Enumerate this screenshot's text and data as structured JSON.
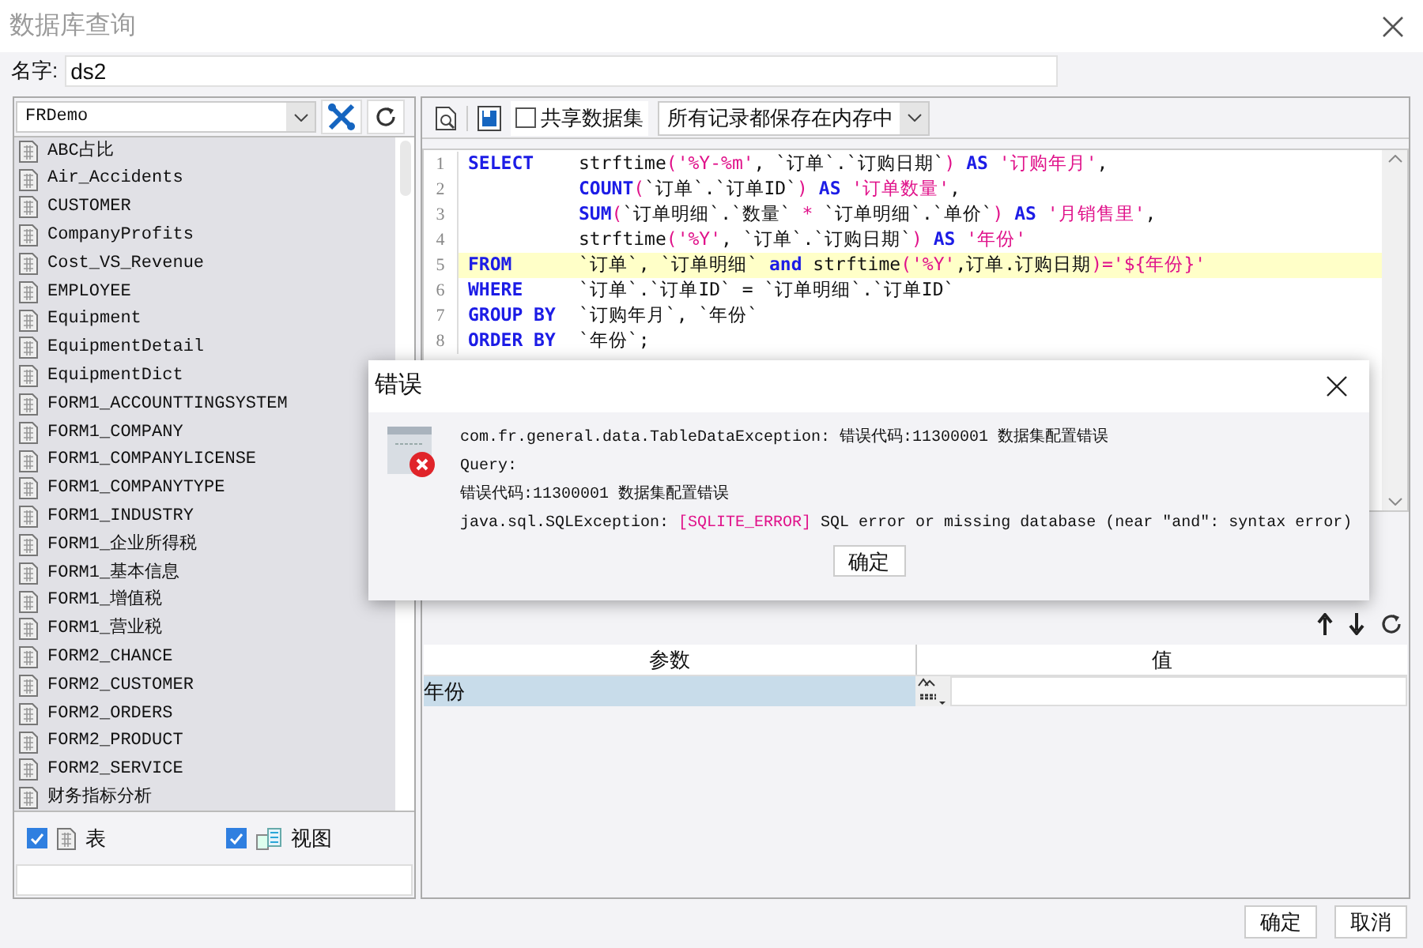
{
  "window": {
    "title": "数据库查询"
  },
  "name_field": {
    "label": "名字:",
    "value": "ds2"
  },
  "connection": {
    "value": "FRDemo"
  },
  "tables": [
    "ABC占比",
    "Air_Accidents",
    "CUSTOMER",
    "CompanyProfits",
    "Cost_VS_Revenue",
    "EMPLOYEE",
    "Equipment",
    "EquipmentDetail",
    "EquipmentDict",
    "FORM1_ACCOUNTTINGSYSTEM",
    "FORM1_COMPANY",
    "FORM1_COMPANYLICENSE",
    "FORM1_COMPANYTYPE",
    "FORM1_INDUSTRY",
    "FORM1_企业所得税",
    "FORM1_基本信息",
    "FORM1_增值税",
    "FORM1_营业税",
    "FORM2_CHANCE",
    "FORM2_CUSTOMER",
    "FORM2_ORDERS",
    "FORM2_PRODUCT",
    "FORM2_SERVICE",
    "财务指标分析"
  ],
  "filters": [
    {
      "label": "表",
      "kind": "table",
      "checked": true
    },
    {
      "label": "视图",
      "kind": "view",
      "checked": true
    }
  ],
  "toolbar": {
    "share": {
      "label": "共享数据集",
      "checked": false
    },
    "storage": {
      "value": "所有记录都保存在内存中"
    }
  },
  "sql_lines": [
    {
      "number": "1",
      "keyword": "SELECT",
      "highlighted": false,
      "tokens": [
        {
          "kind": "text",
          "text": "strftime"
        },
        {
          "kind": "punct",
          "text": "("
        },
        {
          "kind": "string",
          "text": "'%Y-%m'"
        },
        {
          "kind": "text",
          "text": ", `订单`.`订购日期`"
        },
        {
          "kind": "punct",
          "text": ")"
        },
        {
          "kind": "keyword",
          "text": " AS"
        },
        {
          "kind": "string",
          "text": " '订购年月'"
        },
        {
          "kind": "text",
          "text": ","
        }
      ]
    },
    {
      "number": "2",
      "highlighted": false,
      "tokens": [
        {
          "kind": "keyword",
          "text": "COUNT"
        },
        {
          "kind": "punct",
          "text": "("
        },
        {
          "kind": "text",
          "text": "`订单`.`订单ID`"
        },
        {
          "kind": "punct",
          "text": ")"
        },
        {
          "kind": "keyword",
          "text": " AS"
        },
        {
          "kind": "string",
          "text": " '订单数量'"
        },
        {
          "kind": "text",
          "text": ","
        }
      ]
    },
    {
      "number": "3",
      "highlighted": false,
      "tokens": [
        {
          "kind": "keyword",
          "text": "SUM"
        },
        {
          "kind": "punct",
          "text": "("
        },
        {
          "kind": "text",
          "text": "`订单明细`.`数量` "
        },
        {
          "kind": "string",
          "text": "*"
        },
        {
          "kind": "text",
          "text": " `订单明细`.`单价`"
        },
        {
          "kind": "punct",
          "text": ")"
        },
        {
          "kind": "keyword",
          "text": " AS"
        },
        {
          "kind": "string",
          "text": " '月销售里'"
        },
        {
          "kind": "text",
          "text": ","
        }
      ]
    },
    {
      "number": "4",
      "highlighted": false,
      "tokens": [
        {
          "kind": "text",
          "text": "strftime"
        },
        {
          "kind": "punct",
          "text": "("
        },
        {
          "kind": "string",
          "text": "'%Y'"
        },
        {
          "kind": "text",
          "text": ", `订单`.`订购日期`"
        },
        {
          "kind": "punct",
          "text": ")"
        },
        {
          "kind": "keyword",
          "text": " AS"
        },
        {
          "kind": "string",
          "text": " '年份'"
        }
      ]
    },
    {
      "number": "5",
      "keyword": "FROM",
      "highlighted": true,
      "tokens": [
        {
          "kind": "text",
          "text": "`订单`, `订单明细` "
        },
        {
          "kind": "keyword",
          "text": "and"
        },
        {
          "kind": "text",
          "text": " strftime"
        },
        {
          "kind": "punct",
          "text": "("
        },
        {
          "kind": "string",
          "text": "'%Y'"
        },
        {
          "kind": "text",
          "text": ",订单.订购日期"
        },
        {
          "kind": "punct",
          "text": ")="
        },
        {
          "kind": "string",
          "text": "'${年份}'"
        }
      ]
    },
    {
      "number": "6",
      "keyword": "WHERE",
      "highlighted": false,
      "tokens": [
        {
          "kind": "text",
          "text": "`订单`.`订单ID` = `订单明细`.`订单ID`"
        }
      ]
    },
    {
      "number": "7",
      "keyword": "GROUP BY",
      "highlighted": false,
      "tokens": [
        {
          "kind": "text",
          "text": "`订购年月`, `年份`"
        }
      ]
    },
    {
      "number": "8",
      "keyword": "ORDER BY",
      "highlighted": false,
      "tokens": [
        {
          "kind": "text",
          "text": "`年份`;"
        }
      ]
    }
  ],
  "parameters": {
    "columns": [
      "参数",
      "值"
    ],
    "rows": [
      {
        "name": "年份",
        "value": "",
        "selected": true
      }
    ]
  },
  "buttons": [
    "确定",
    "取消"
  ],
  "error_dialog": {
    "title": "错误",
    "lines": [
      [
        {
          "kind": "text",
          "text": "com.fr.general.data.TableDataException: 错误代码:11300001 数据集配置错误"
        }
      ],
      [
        {
          "kind": "text",
          "text": "Query:"
        }
      ],
      [
        {
          "kind": "text",
          "text": "错误代码:11300001 数据集配置错误"
        }
      ],
      [
        {
          "kind": "text",
          "text": "java.sql.SQLException: "
        },
        {
          "kind": "error",
          "text": "[SQLITE_ERROR]"
        },
        {
          "kind": "text",
          "text": " SQL error or missing database (near \"and\": syntax error)"
        }
      ]
    ],
    "button": "确定"
  }
}
